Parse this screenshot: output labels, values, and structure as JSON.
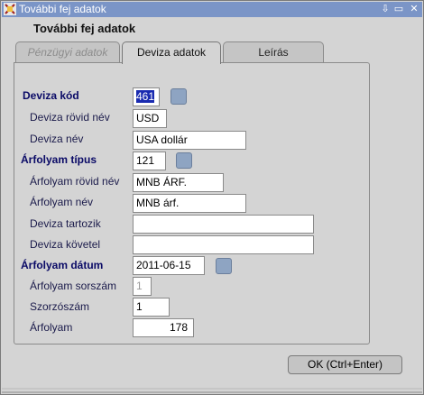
{
  "window": {
    "title": "További fej adatok"
  },
  "form": {
    "heading": "További fej adatok"
  },
  "tabs": [
    {
      "label": "Pénzügyi adatok",
      "state": "disabled"
    },
    {
      "label": "Deviza adatok",
      "state": "active"
    },
    {
      "label": "Leírás",
      "state": "inactive"
    }
  ],
  "fields": {
    "deviza_kod": {
      "label": "Deviza kód",
      "value": "461"
    },
    "deviza_rovid_nev": {
      "label": "Deviza rövid név",
      "value": "USD"
    },
    "deviza_nev": {
      "label": "Deviza név",
      "value": "USA dollár"
    },
    "arfolyam_tipus": {
      "label": "Árfolyam típus",
      "value": "121"
    },
    "arfolyam_rovid_nev": {
      "label": "Árfolyam rövid név",
      "value": "MNB ÁRF."
    },
    "arfolyam_nev": {
      "label": "Árfolyam név",
      "value": "MNB árf."
    },
    "deviza_tartozik": {
      "label": "Deviza tartozik",
      "value": ""
    },
    "deviza_kovetel": {
      "label": "Deviza követel",
      "value": ""
    },
    "arfolyam_datum": {
      "label": "Árfolyam dátum",
      "value": "2011-06-15"
    },
    "arfolyam_sorszam": {
      "label": "Árfolyam sorszám",
      "value": "1"
    },
    "szorzoszam": {
      "label": "Szorzószám",
      "value": "1"
    },
    "arfolyam": {
      "label": "Árfolyam",
      "value": "178"
    }
  },
  "buttons": {
    "ok": "OK (Ctrl+Enter)"
  },
  "colors": {
    "titlebar": "#7b95c7",
    "selection": "#1a2bb0",
    "label_bold": "#0a0a66",
    "lov_button": "#8ea4c2"
  }
}
